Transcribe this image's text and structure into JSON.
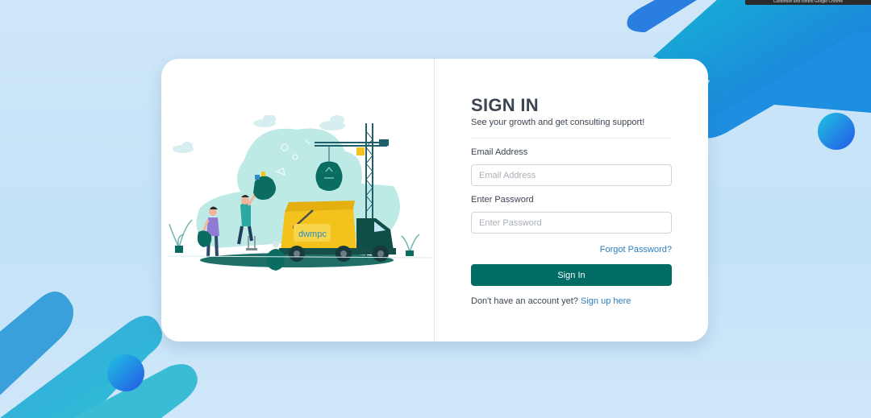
{
  "browser_notice": "Customize and control Google Chrome",
  "login": {
    "title": "SIGN IN",
    "subtitle": "See your growth and get consulting support!",
    "email_label": "Email Address",
    "email_placeholder": "Email Address",
    "email_value": "",
    "password_label": "Enter Password",
    "password_placeholder": "Enter Password",
    "password_value": "",
    "forgot_link": "Forgot Password?",
    "submit_label": "Sign In",
    "signup_prompt": "Don't have an account yet?",
    "signup_link": "Sign up here"
  },
  "illustration": {
    "truck_logo_text": "dwmpc"
  },
  "colors": {
    "primary_button": "#006c63",
    "link": "#2a7fc1",
    "heading": "#3b4652",
    "truck_body": "#f3c21c",
    "illustration_teal": "#a7e3dc",
    "illustration_dark": "#0b5d55",
    "deco_blue": "#1f7fe0",
    "deco_cyan": "#1ab3d6"
  }
}
